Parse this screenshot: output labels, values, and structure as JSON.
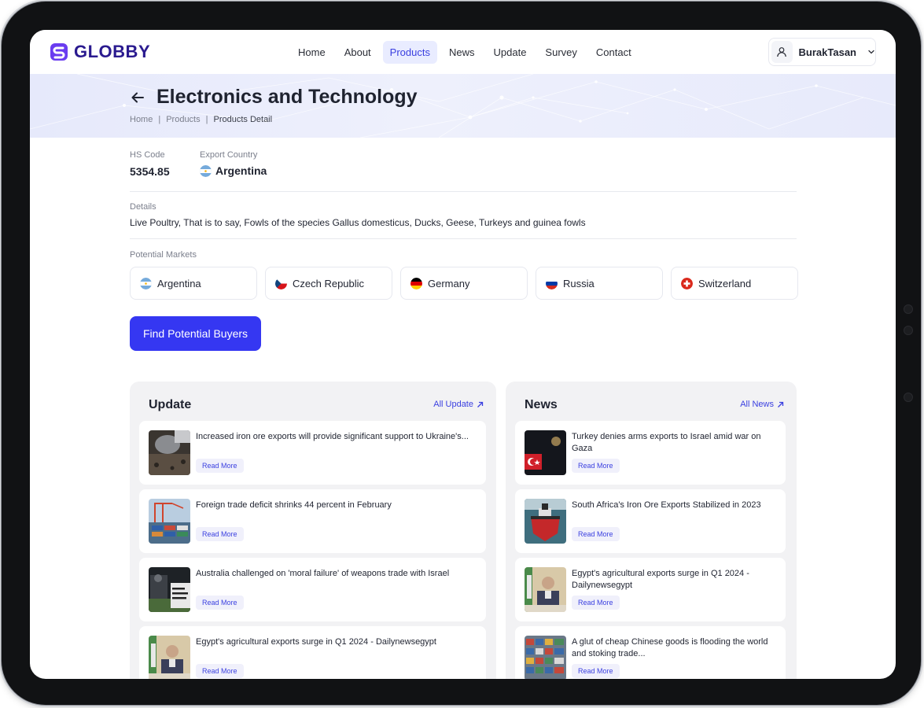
{
  "brand": {
    "name": "GLOBBY",
    "color": "#2a1a8f",
    "accent": "#3537f2"
  },
  "nav": [
    {
      "label": "Home",
      "active": false
    },
    {
      "label": "About",
      "active": false
    },
    {
      "label": "Products",
      "active": true
    },
    {
      "label": "News",
      "active": false
    },
    {
      "label": "Update",
      "active": false
    },
    {
      "label": "Survey",
      "active": false
    },
    {
      "label": "Contact",
      "active": false
    }
  ],
  "user": {
    "name": "BurakTasan",
    "icon": "user-icon"
  },
  "page": {
    "title": "Electronics and Technology",
    "breadcrumb": {
      "home": "Home",
      "products": "Products",
      "current": "Products Detail"
    }
  },
  "product": {
    "hs_label": "HS Code",
    "hs_value": "5354.85",
    "export_label": "Export Country",
    "export_value": "Argentina",
    "details_label": "Details",
    "details_text": "Live Poultry, That is to say, Fowls of the species Gallus domesticus, Ducks, Geese, Turkeys and guinea fowls",
    "markets_label": "Potential Markets",
    "markets": [
      {
        "name": "Argentina",
        "flag": "argentina"
      },
      {
        "name": "Czech Republic",
        "flag": "czech"
      },
      {
        "name": "Germany",
        "flag": "germany"
      },
      {
        "name": "Russia",
        "flag": "russia"
      },
      {
        "name": "Switzerland",
        "flag": "switzerland"
      }
    ],
    "cta": "Find Potential Buyers"
  },
  "update": {
    "title": "Update",
    "link": "All Update",
    "read_more": "Read More",
    "items": [
      {
        "title": "Increased iron ore exports will provide significant support to Ukraine's..."
      },
      {
        "title": "Foreign trade deficit shrinks 44 percent in February"
      },
      {
        "title": "Australia challenged on 'moral failure' of weapons trade with Israel"
      },
      {
        "title": "Egypt's agricultural exports surge in Q1 2024 - Dailynewsegypt"
      }
    ]
  },
  "news": {
    "title": "News",
    "link": "All News",
    "read_more": "Read More",
    "items": [
      {
        "title": "Turkey denies arms exports to Israel amid war on Gaza"
      },
      {
        "title": "South Africa's Iron Ore Exports Stabilized in 2023"
      },
      {
        "title": "Egypt's agricultural exports surge in Q1 2024 - Dailynewsegypt"
      },
      {
        "title": "A glut of cheap Chinese goods is flooding the world and stoking trade..."
      }
    ]
  }
}
